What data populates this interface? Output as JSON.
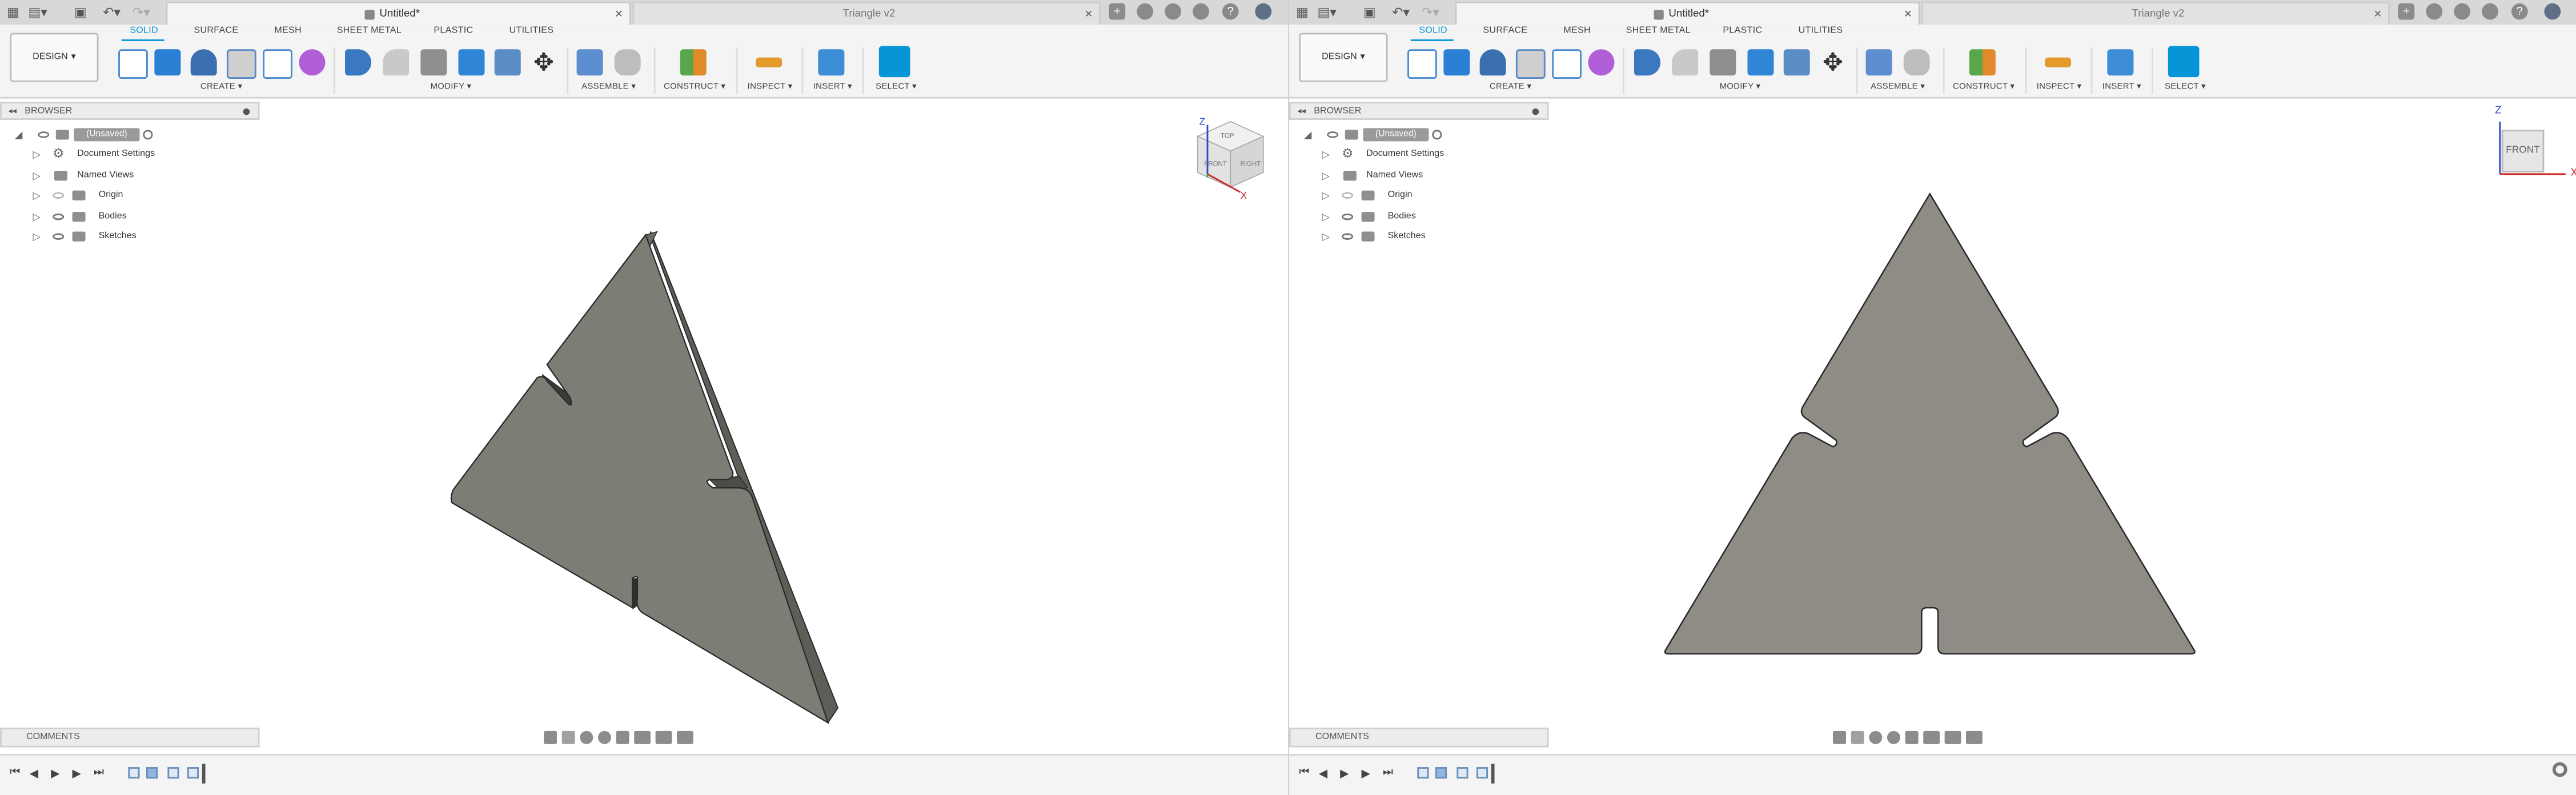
{
  "panes": [
    {
      "window": {
        "active_tab": "Untitled*",
        "inactive_tab": "Triangle v2",
        "close_glyph": "×"
      },
      "ribbon": {
        "workspace": "DESIGN",
        "workspace_chevron": "▾",
        "tabs": [
          "SOLID",
          "SURFACE",
          "MESH",
          "SHEET METAL",
          "PLASTIC",
          "UTILITIES"
        ],
        "groups": [
          "CREATE ▾",
          "MODIFY ▾",
          "ASSEMBLE ▾",
          "CONSTRUCT ▾",
          "INSPECT ▾",
          "INSERT ▾",
          "SELECT ▾"
        ]
      },
      "browser": {
        "title": "BROWSER",
        "root": "(Unsaved)",
        "items": [
          "Document Settings",
          "Named Views",
          "Origin",
          "Bodies",
          "Sketches"
        ]
      },
      "comments": "COMMENTS",
      "viewcube": {
        "style": "isometric",
        "labels": [
          "TOP",
          "FRONT",
          "RIGHT"
        ],
        "axes": [
          "Z",
          "X"
        ]
      }
    },
    {
      "window": {
        "active_tab": "Untitled*",
        "inactive_tab": "Triangle v2",
        "close_glyph": "×"
      },
      "ribbon": {
        "workspace": "DESIGN",
        "workspace_chevron": "▾",
        "tabs": [
          "SOLID",
          "SURFACE",
          "MESH",
          "SHEET METAL",
          "PLASTIC",
          "UTILITIES"
        ],
        "groups": [
          "CREATE ▾",
          "MODIFY ▾",
          "ASSEMBLE ▾",
          "CONSTRUCT ▾",
          "INSPECT ▾",
          "INSERT ▾",
          "SELECT ▾"
        ]
      },
      "browser": {
        "title": "BROWSER",
        "root": "(Unsaved)",
        "items": [
          "Document Settings",
          "Named Views",
          "Origin",
          "Bodies",
          "Sketches"
        ]
      },
      "comments": "COMMENTS",
      "viewcube": {
        "style": "front",
        "labels": [
          "FRONT"
        ],
        "axes": [
          "Z",
          "X"
        ]
      }
    }
  ],
  "colors": {
    "accent": "#0696d7",
    "model_face": "#8c8a81",
    "model_edge": "#2b2b2b",
    "axis_z": "#3048c8",
    "axis_x": "#d02828"
  },
  "icons": {
    "app_menu": "grid-icon",
    "file": "file-icon",
    "save": "save-icon",
    "undo": "undo-icon",
    "redo": "redo-icon",
    "new_tab": "plus-icon",
    "help": "help-icon",
    "user": "avatar-icon"
  }
}
